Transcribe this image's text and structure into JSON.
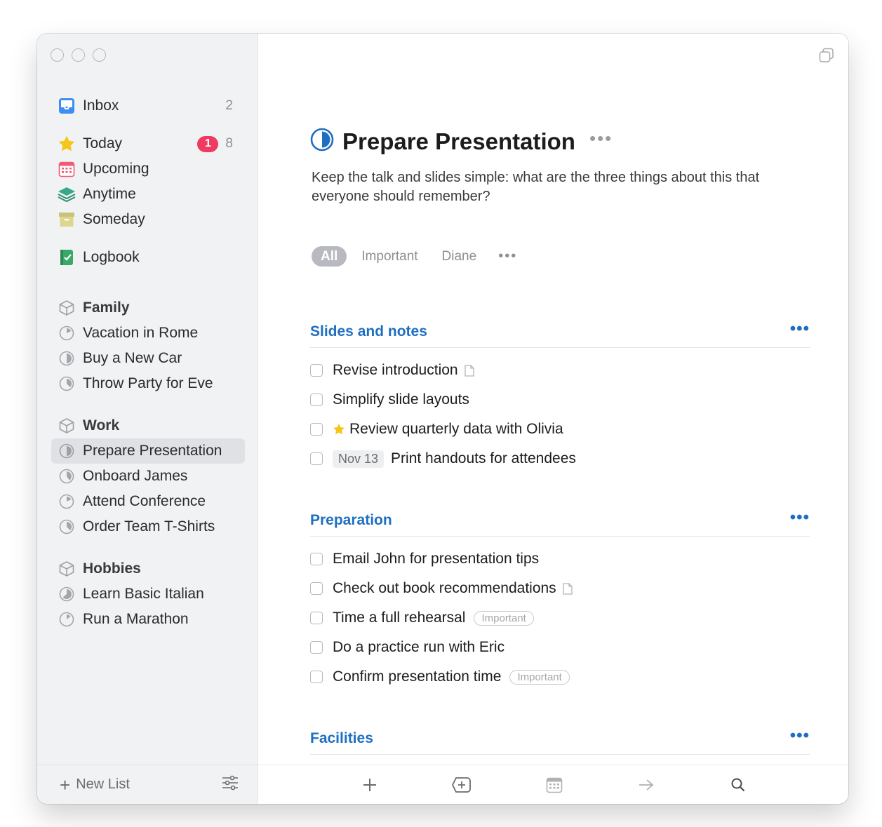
{
  "sidebar": {
    "inbox": {
      "label": "Inbox",
      "count": "2"
    },
    "today": {
      "label": "Today",
      "badge": "1",
      "count": "8"
    },
    "upcoming": {
      "label": "Upcoming"
    },
    "anytime": {
      "label": "Anytime"
    },
    "someday": {
      "label": "Someday"
    },
    "logbook": {
      "label": "Logbook"
    },
    "areas": [
      {
        "label": "Family",
        "projects": [
          "Vacation in Rome",
          "Buy a New Car",
          "Throw Party for Eve"
        ]
      },
      {
        "label": "Work",
        "projects": [
          "Prepare Presentation",
          "Onboard James",
          "Attend Conference",
          "Order Team T-Shirts"
        ]
      },
      {
        "label": "Hobbies",
        "projects": [
          "Learn Basic Italian",
          "Run a Marathon"
        ]
      }
    ],
    "footer": {
      "new_list": "New List"
    }
  },
  "project": {
    "title": "Prepare Presentation",
    "notes": "Keep the talk and slides simple: what are the three things about this that everyone should remember?",
    "filters": [
      "All",
      "Important",
      "Diane"
    ],
    "sections": [
      {
        "title": "Slides and notes",
        "todos": [
          {
            "text": "Revise introduction"
          },
          {
            "text": "Simplify slide layouts"
          },
          {
            "text": "Review quarterly data with Olivia"
          },
          {
            "date": "Nov 13",
            "text": "Print handouts for attendees"
          }
        ]
      },
      {
        "title": "Preparation",
        "todos": [
          {
            "text": "Email John for presentation tips"
          },
          {
            "text": "Check out book recommendations"
          },
          {
            "text": "Time a full rehearsal",
            "tag": "Important"
          },
          {
            "text": "Do a practice run with Eric"
          },
          {
            "text": "Confirm presentation time",
            "tag": "Important"
          }
        ]
      },
      {
        "title": "Facilities",
        "todos": []
      }
    ]
  },
  "colors": {
    "accent": "#1e6fc2",
    "badge": "#f03a5f",
    "today_star": "#f5c518"
  }
}
